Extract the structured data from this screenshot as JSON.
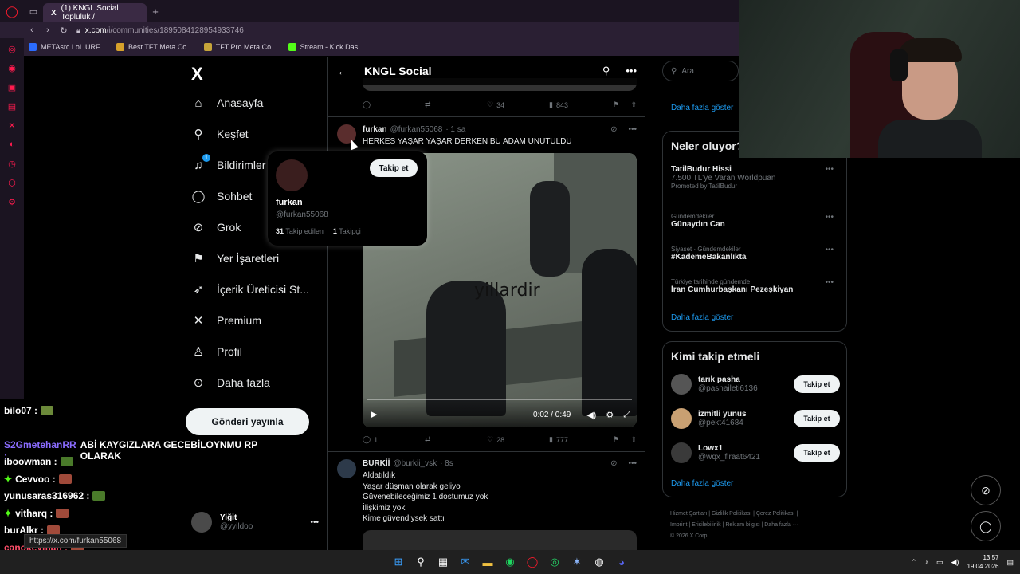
{
  "browser": {
    "tab_title": "(1) KNGL Social Topluluk /",
    "url_host": "x.com",
    "url_path": "/i/communities/1895084128954933746",
    "bookmarks": [
      "METAsrc LoL URF...",
      "Best TFT Meta Co...",
      "TFT Pro Meta Co...",
      "Stream - Kick Das..."
    ]
  },
  "nav": {
    "items": [
      "Anasayfa",
      "Keşfet",
      "Bildirimler",
      "Sohbet",
      "Grok",
      "Yer İşaretleri",
      "İçerik Üreticisi St...",
      "Premium",
      "Profil",
      "Daha fazla"
    ],
    "notif_count": "1",
    "post_button": "Gönderi yayınla",
    "account_name": "Yiğit",
    "account_handle": "@yyildoo"
  },
  "main": {
    "title": "KNGL Social",
    "prev_tweet_actions": {
      "likes": "34",
      "views": "843"
    },
    "tweet1": {
      "name": "furkan",
      "handle": "@furkan55068",
      "time": "· 1 sa",
      "text": "HERKES YAŞAR YAŞAR DERKEN BU ADAM UNUTULDU",
      "video_overlay": "yillardir",
      "video_time": "0:02 / 0:49",
      "replies": "1",
      "likes": "28",
      "views": "777"
    },
    "tweet2": {
      "name": "BURKİİ",
      "handle": "@burkii_vsk",
      "time": "· 8s",
      "lines": [
        "Aldatıldık",
        "Yaşar düşman olarak geliyo",
        "Güvenebileceğimiz 1 dostumuz yok",
        "İlişkimiz yok",
        "Kime güvendiysek sattı"
      ]
    }
  },
  "hovercard": {
    "name": "furkan",
    "handle": "@furkan55068",
    "follow": "Takip et",
    "following_count": "31",
    "following_label": "Takip edilen",
    "followers_count": "1",
    "followers_label": "Takipçi"
  },
  "right": {
    "search_placeholder": "Ara",
    "more": "Daha fazla göster",
    "trends_title": "Neler oluyor?",
    "trends": [
      {
        "cat": "",
        "title": "TatilBudur Hissi",
        "sub": "7.500 TL'ye Varan Worldpuan",
        "promo": "Promoted by TatilBudur"
      },
      {
        "cat": "Gündemdekiler",
        "title": "Günaydın Can",
        "sub": "",
        "promo": ""
      },
      {
        "cat": "Siyaset · Gündemdekiler",
        "title": "#KademeBakanlıkta",
        "sub": "",
        "promo": ""
      },
      {
        "cat": "Türkiye tarihinde gündemde",
        "title": "İran Cumhurbaşkanı Pezeşkiyan",
        "sub": "",
        "promo": ""
      }
    ],
    "wtf_title": "Kimi takip etmeli",
    "wtf": [
      {
        "name": "tarık pasha",
        "handle": "@pashaileti6136"
      },
      {
        "name": "izmitli yunus",
        "handle": "@pekt41684"
      },
      {
        "name": "Lowx1",
        "handle": "@wqx_flraat6421"
      }
    ],
    "follow": "Takip et",
    "footer_line1": "Hizmet Şartları | Gizlilik Politikası | Çerez Politikası |",
    "footer_line2": "Imprint | Erişilebilirlik | Reklam bilgisi | Daha fazla ···",
    "footer_line3": "© 2026 X Corp."
  },
  "chat": [
    {
      "user": "bilo07 :",
      "color": "#ffffff",
      "msg": ""
    },
    {
      "user": "S2GmetehanRR :",
      "color": "#8a6cff",
      "msg": "ABİ KAYGIZLARA GECEBİLOYNMU RP OLARAK"
    },
    {
      "user": "iboowman :",
      "color": "#ffffff",
      "msg": ""
    },
    {
      "user": "Cevvoo :",
      "color": "#ffffff",
      "msg": ""
    },
    {
      "user": "yunusaras316962 :",
      "color": "#ffffff",
      "msg": ""
    },
    {
      "user": "vitharq :",
      "color": "#ffffff",
      "msg": ""
    },
    {
      "user": "burAlkr :",
      "color": "#ffffff",
      "msg": ""
    },
    {
      "user": "canokeyman :",
      "color": "#ff4f6a",
      "msg": ""
    }
  ],
  "status_url": "https://x.com/furkan55068",
  "taskbar": {
    "time": "13:57",
    "date": "19.04.2026"
  }
}
